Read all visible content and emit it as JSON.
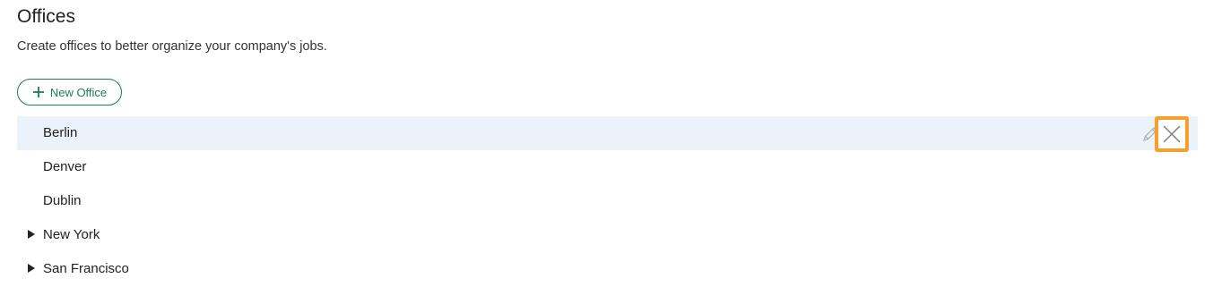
{
  "page": {
    "title": "Offices",
    "subtitle": "Create offices to better organize your company's jobs."
  },
  "toolbar": {
    "new_office_label": "New Office"
  },
  "colors": {
    "accent_green": "#1d7a5f",
    "row_highlight": "#ebf2f9",
    "focus_orange": "#f5a02a"
  },
  "offices": [
    {
      "name": "Berlin",
      "expandable": false,
      "highlighted": true
    },
    {
      "name": "Denver",
      "expandable": false,
      "highlighted": false
    },
    {
      "name": "Dublin",
      "expandable": false,
      "highlighted": false
    },
    {
      "name": "New York",
      "expandable": true,
      "highlighted": false
    },
    {
      "name": "San Francisco",
      "expandable": true,
      "highlighted": false
    }
  ],
  "icons": {
    "add": "plus-icon",
    "edit": "pencil-icon",
    "delete": "close-icon",
    "expand": "caret-right-icon"
  }
}
